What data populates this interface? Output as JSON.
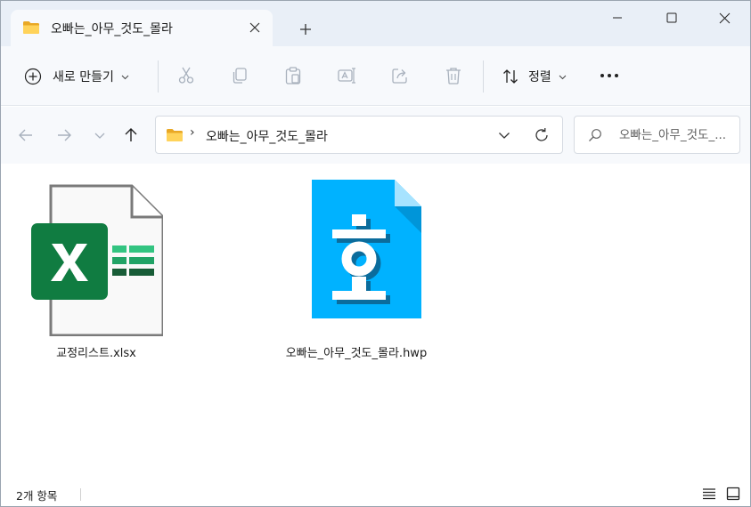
{
  "tab": {
    "title": "오빠는_아무_것도_몰라"
  },
  "commandbar": {
    "new_label": "새로 만들기",
    "sort_label": "정렬"
  },
  "address": {
    "path_sep": "›",
    "path": "오빠는_아무_것도_몰라"
  },
  "search": {
    "placeholder": "오빠는_아무_것도_..."
  },
  "files": [
    {
      "name": "교정리스트.xlsx",
      "icon": "excel-file-icon"
    },
    {
      "name": "오빠는_아무_것도_몰라.hwp",
      "icon": "hwp-file-icon"
    }
  ],
  "status": {
    "item_count": "2개 항목"
  },
  "colors": {
    "titlebar": "#e9eff7",
    "toolbar": "#f7f9fc",
    "excel_green": "#107c41",
    "hwp_blue": "#00b2ff",
    "folder_yellow": "#f8c543"
  }
}
